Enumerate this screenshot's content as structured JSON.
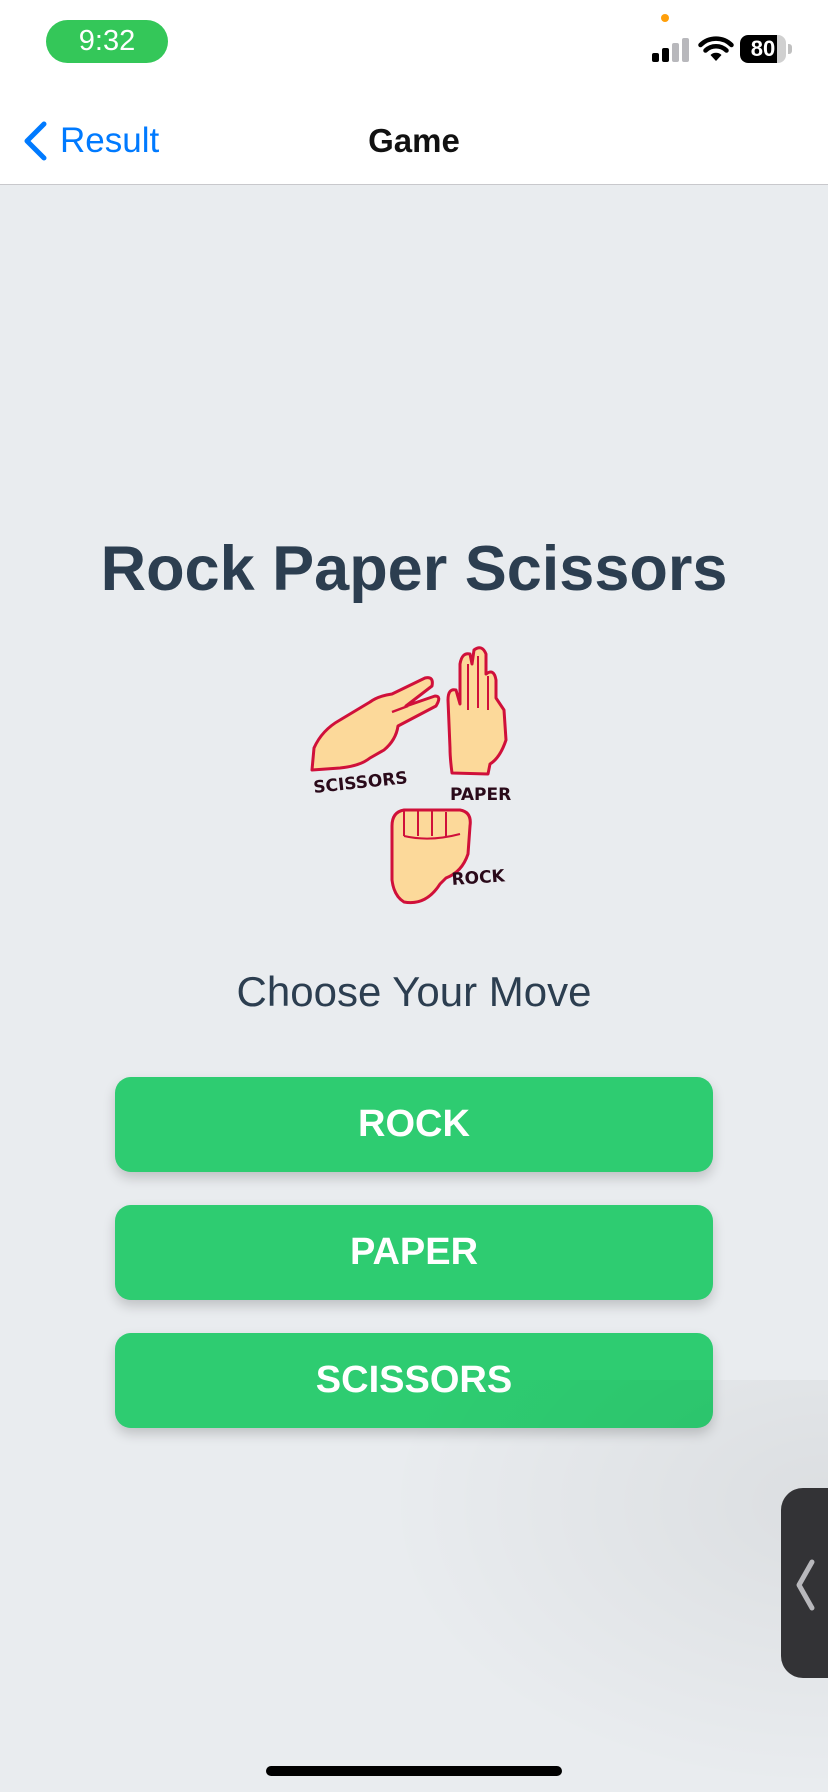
{
  "status_bar": {
    "time": "9:32",
    "battery": "80",
    "battery_level": 0.8,
    "signal_bars": 2,
    "signal_total": 4
  },
  "nav_bar": {
    "back_label": "Result",
    "title": "Game"
  },
  "main": {
    "title": "Rock Paper Scissors",
    "illustration_labels": {
      "scissors": "SCISSORS",
      "paper": "PAPER",
      "rock": "ROCK"
    },
    "subtitle": "Choose Your Move",
    "buttons": [
      {
        "label": "ROCK"
      },
      {
        "label": "PAPER"
      },
      {
        "label": "SCISSORS"
      }
    ]
  },
  "colors": {
    "accent": "#007aff",
    "button": "#2ecc71",
    "title_text": "#2c3e50",
    "background": "#e9ecef",
    "time_pill": "#34c759",
    "hand_fill": "#fcd99a",
    "hand_outline": "#d0103a"
  },
  "icons": {
    "back": "chevron-left-icon",
    "wifi": "wifi-icon",
    "signal": "cellular-signal-icon",
    "battery": "battery-icon",
    "side_handle": "chevron-left-icon"
  }
}
